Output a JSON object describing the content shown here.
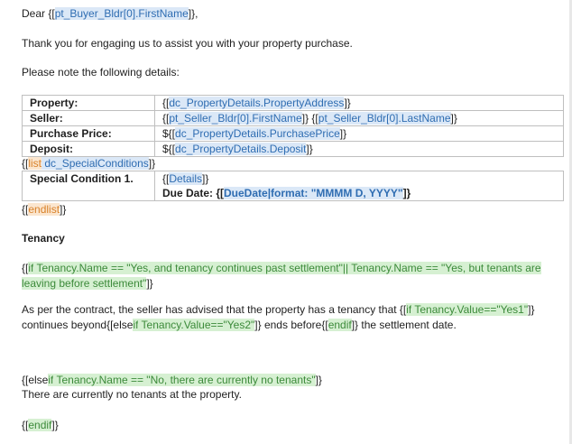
{
  "greeting": {
    "prefix": "Dear {[",
    "field": "pt_Buyer_Bldr[0].FirstName",
    "suffix": "]},"
  },
  "intro": "Thank you for engaging us to assist you with your property purchase.",
  "note": "Please note the following details:",
  "details_table": {
    "property": {
      "label": "Property:",
      "pre": "{[",
      "field": "dc_PropertyDetails.PropertyAddress",
      "post": "]}"
    },
    "seller": {
      "label": "Seller:",
      "pre": "{[",
      "field1": "pt_Seller_Bldr[0].FirstName",
      "mid": "]} {[",
      "field2": "pt_Seller_Bldr[0].LastName",
      "post": "]}"
    },
    "price": {
      "label": "Purchase Price:",
      "pre": "${[",
      "field": "dc_PropertyDetails.PurchasePrice",
      "post": "]}"
    },
    "deposit": {
      "label": "Deposit:",
      "pre": "${[",
      "field": "dc_PropertyDetails.Deposit",
      "post": "]}"
    }
  },
  "list_tag": {
    "pre": "{[",
    "keyword": "list",
    "field": " dc_SpecialConditions",
    "post": "]}"
  },
  "special_table": {
    "label": "Special Condition 1.",
    "details_pre": "{[",
    "details_field": "Details",
    "details_post": "]}",
    "due_label": "Due Date: {[",
    "due_field": "DueDate|format: \"MMMM D, YYYY\"",
    "due_post": "]}"
  },
  "endlist_tag": {
    "pre": "{[",
    "keyword": "endlist",
    "post": "]}"
  },
  "tenancy_heading": "Tenancy",
  "if_block": {
    "pre": "{[",
    "keyword": "if",
    "condition": " Tenancy.Name == \"Yes, and tenancy continues past settlement\"|| Tenancy.Name == \"Yes, but tenants are leaving before settlement\"",
    "post": "]}"
  },
  "contract_para": {
    "text1": "As per the contract, the seller has advised that the property has a tenancy that {[",
    "if1": "if",
    "cond1": " Tenancy.Value==\"Yes1\"",
    "text2": "]} continues beyond{[else",
    "if2": "if",
    "cond2": " Tenancy.Value==\"Yes2\"",
    "text3": "]} ends before{[",
    "endif": "endif",
    "text4": "]} the settlement date."
  },
  "elseif_block": {
    "pre": "{[else",
    "keyword": "if",
    "condition": " Tenancy.Name == \"No, there are currently no tenants\"",
    "post": "]}"
  },
  "no_tenants": "There are currently no tenants at the property.",
  "endif_tag": {
    "pre": "{[",
    "keyword": "endif",
    "post": "]}"
  }
}
